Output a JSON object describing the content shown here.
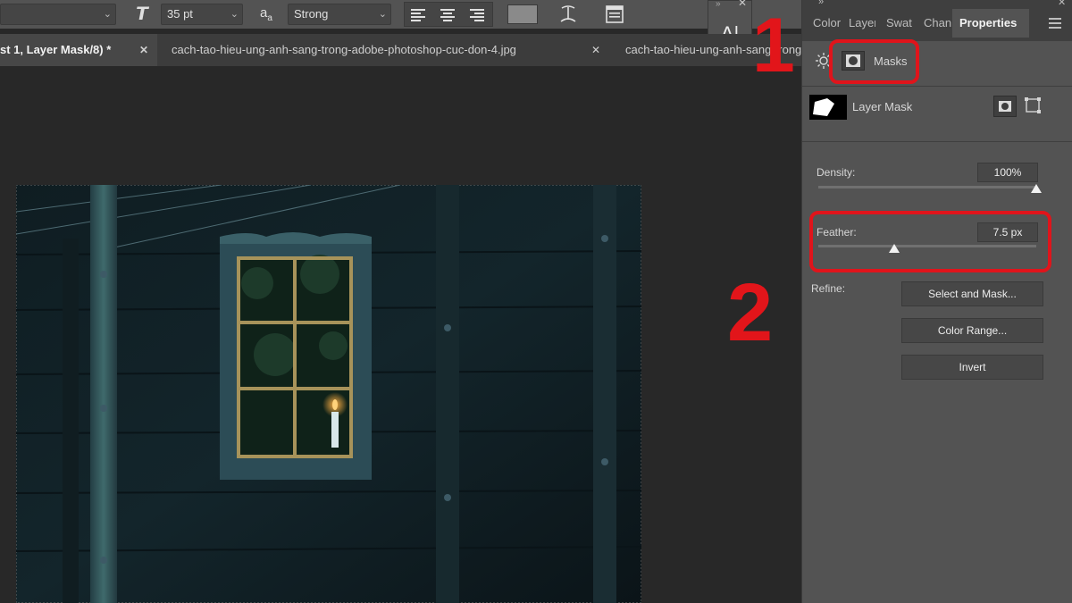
{
  "options_bar": {
    "font_size": "35 pt",
    "aa_label": "a",
    "aa_sub": "a",
    "antialias": "Strong"
  },
  "char_float": {
    "label": "A|"
  },
  "tabs": [
    {
      "label": "st 1, Layer Mask/8) *",
      "close": "✕"
    },
    {
      "label": "cach-tao-hieu-ung-anh-sang-trong-adobe-photoshop-cuc-don-4.jpg",
      "close": "✕"
    },
    {
      "label": "cach-tao-hieu-ung-anh-sang-trong-adobe-photoshop-cuc-don-"
    }
  ],
  "panel": {
    "tabs": [
      "Color",
      "Layer",
      "Swat",
      "Chan",
      "Properties"
    ],
    "masks_label": "Masks",
    "layer_mask_label": "Layer Mask",
    "density": {
      "label": "Density:",
      "value": "100%",
      "level": 1.0
    },
    "feather": {
      "label": "Feather:",
      "value": "7.5 px",
      "level": 0.35
    },
    "refine_label": "Refine:",
    "buttons": {
      "select_mask": "Select and Mask...",
      "color_range": "Color Range...",
      "invert": "Invert"
    }
  },
  "annotations": {
    "one": "1",
    "two": "2"
  },
  "colors": {
    "annotation": "#e2151a",
    "panel_bg": "#535353",
    "canvas_bg": "#282828"
  }
}
